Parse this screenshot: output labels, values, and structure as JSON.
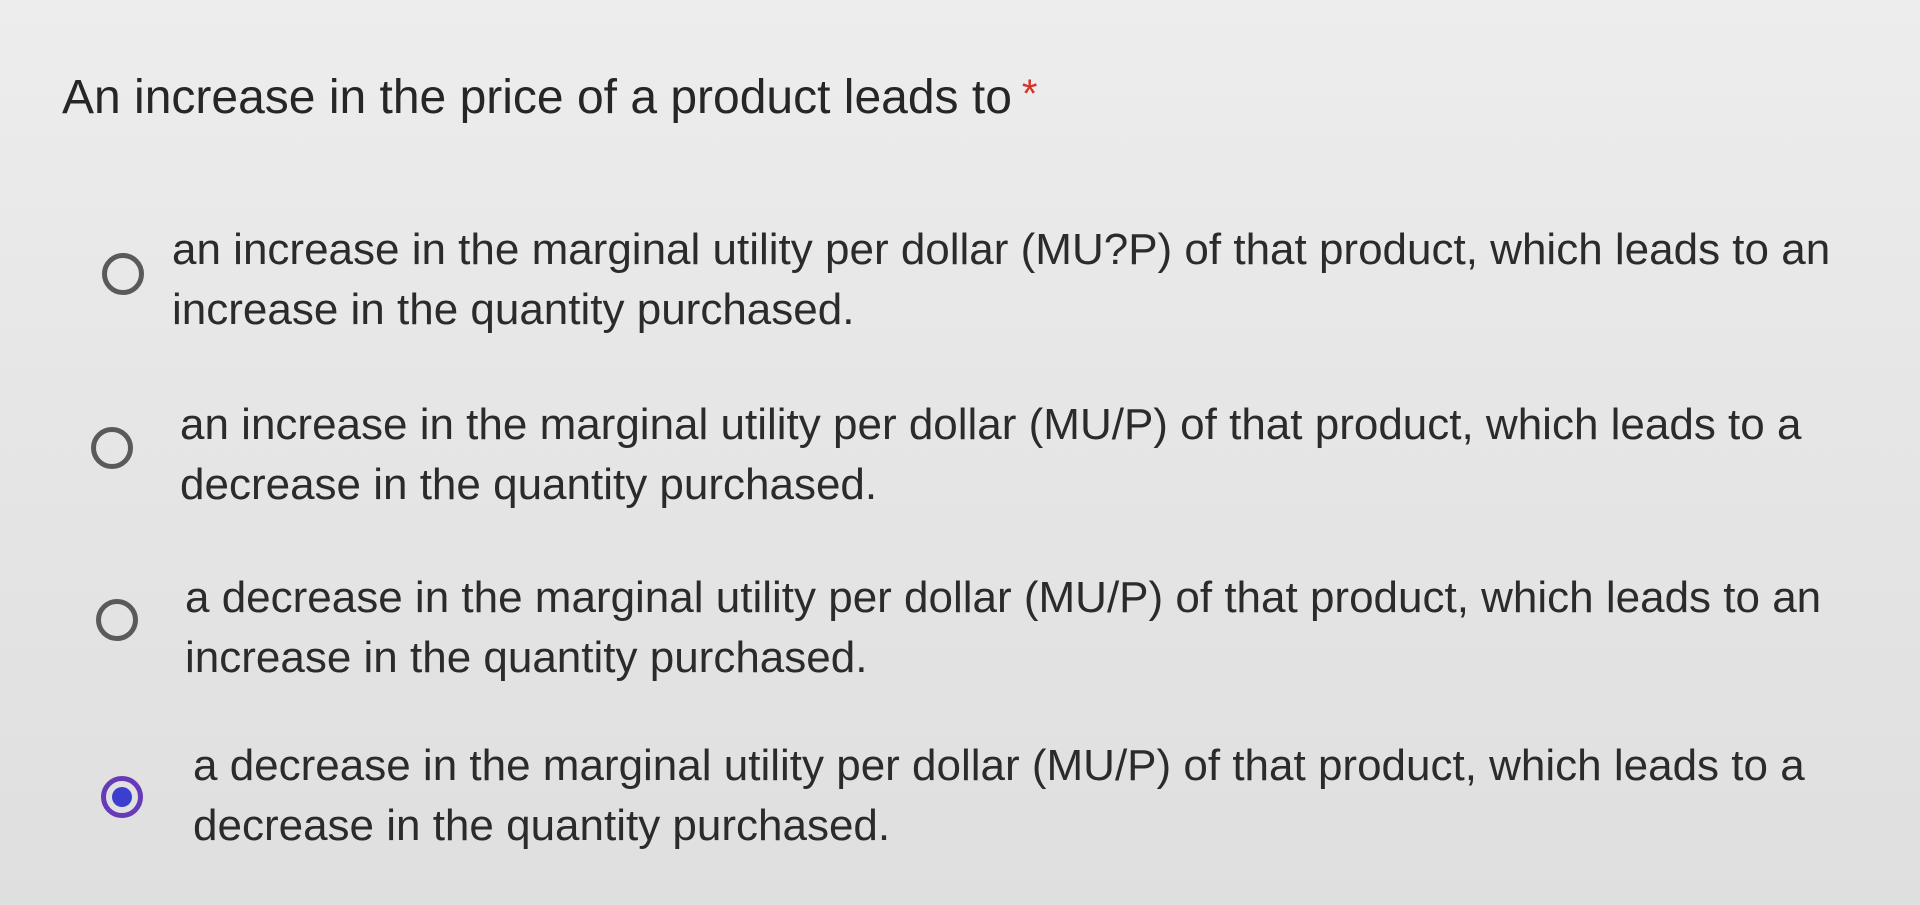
{
  "question": {
    "title": "An increase in the price of a product leads to",
    "required_marker": "*"
  },
  "options": [
    {
      "label": "an increase in the marginal utility per dollar (MU?P) of that product, which leads to an increase in the quantity purchased.",
      "selected": false
    },
    {
      "label": "an increase in the marginal utility per dollar (MU/P) of that product, which leads to a decrease in the quantity purchased.",
      "selected": false
    },
    {
      "label": "a decrease in the marginal utility per dollar (MU/P) of that product, which leads to an increase in the quantity purchased.",
      "selected": false
    },
    {
      "label": "a decrease in the marginal utility per dollar (MU/P) of that product, which leads to a decrease in the quantity purchased.",
      "selected": true
    }
  ],
  "colors": {
    "radio_border": "#5a5a5a",
    "radio_selected_border": "#673ab7",
    "radio_selected_fill": "#3a3fd0",
    "required_star": "#d93025",
    "text": "#2b2b2b"
  },
  "icons": {
    "unselected": "radio-unchecked-icon",
    "selected": "radio-checked-icon"
  }
}
